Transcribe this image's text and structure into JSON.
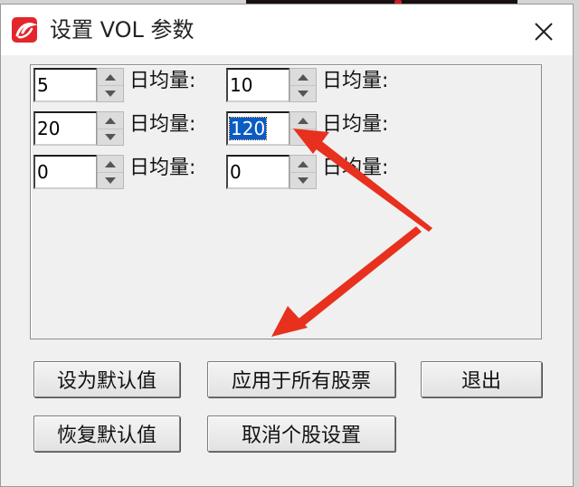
{
  "window": {
    "title": "设置 VOL 参数",
    "close_glyph": "✕"
  },
  "params": [
    {
      "value": "5",
      "unit": "日均量:"
    },
    {
      "value": "10",
      "unit": "日均量:"
    },
    {
      "value": "20",
      "unit": "日均量:"
    },
    {
      "value": "120",
      "unit": "日均量:",
      "selected": true
    },
    {
      "value": "0",
      "unit": "日均量:"
    },
    {
      "value": "0",
      "unit": "日均量:"
    }
  ],
  "buttons": {
    "set_default": "设为默认值",
    "apply_all": "应用于所有股票",
    "exit": "退出",
    "restore_default": "恢复默认值",
    "cancel_individual": "取消个股设置"
  },
  "icons": {
    "app": "app-logo-icon",
    "close": "close-icon",
    "spin_up": "spin-up-icon",
    "spin_down": "spin-down-icon"
  },
  "colors": {
    "selection": "#0a5bc4",
    "annotation_arrow": "#e8301e",
    "app_icon": "#e4262c"
  }
}
